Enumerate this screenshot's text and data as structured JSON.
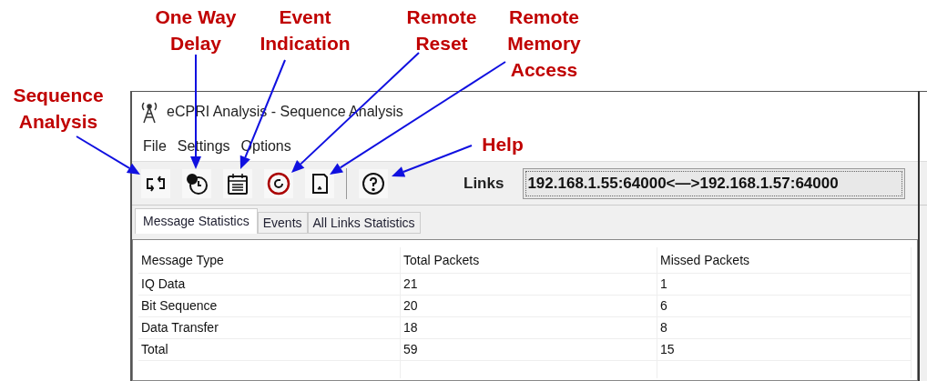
{
  "annotations": [
    {
      "label": "Sequence Analysis"
    },
    {
      "label": "One Way Delay"
    },
    {
      "label": "Event Indication"
    },
    {
      "label": "Remote Reset"
    },
    {
      "label": "Remote Memory Access"
    },
    {
      "label": "Help"
    }
  ],
  "window": {
    "title": "eCPRI Analysis - Sequence Analysis"
  },
  "menu": [
    "File",
    "Settings",
    "Options"
  ],
  "links": {
    "label": "Links",
    "value": "192.168.1.55:64000<—>192.168.1.57:64000"
  },
  "tabs": [
    {
      "label": "Message Statistics",
      "selected": true
    },
    {
      "label": "Events",
      "selected": false
    },
    {
      "label": "All Links Statistics",
      "selected": false
    }
  ],
  "table": {
    "columns": [
      "Message Type",
      "Total Packets",
      "Missed Packets"
    ],
    "rows": [
      [
        "IQ Data",
        "21",
        "1"
      ],
      [
        "Bit Sequence",
        "20",
        "6"
      ],
      [
        "Data Transfer",
        "18",
        "8"
      ],
      [
        "Total",
        "59",
        "15"
      ]
    ]
  }
}
